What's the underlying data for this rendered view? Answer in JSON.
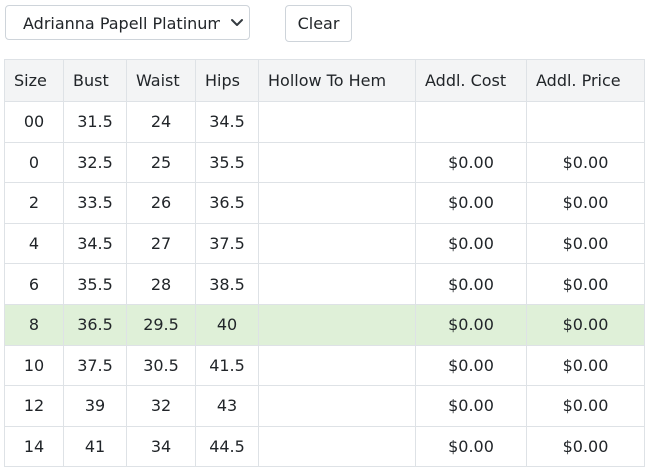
{
  "controls": {
    "select_value": "Adrianna Papell Platinum E",
    "clear_label": "Clear"
  },
  "table": {
    "headers": [
      "Size",
      "Bust",
      "Waist",
      "Hips",
      "Hollow To Hem",
      "Addl. Cost",
      "Addl. Price"
    ],
    "highlight_color": "#dff0d8",
    "rows": [
      {
        "size": "00",
        "bust": "31.5",
        "waist": "24",
        "hips": "34.5",
        "hollow": "",
        "cost": "",
        "price": "",
        "highlighted": false
      },
      {
        "size": "0",
        "bust": "32.5",
        "waist": "25",
        "hips": "35.5",
        "hollow": "",
        "cost": "$0.00",
        "price": "$0.00",
        "highlighted": false
      },
      {
        "size": "2",
        "bust": "33.5",
        "waist": "26",
        "hips": "36.5",
        "hollow": "",
        "cost": "$0.00",
        "price": "$0.00",
        "highlighted": false
      },
      {
        "size": "4",
        "bust": "34.5",
        "waist": "27",
        "hips": "37.5",
        "hollow": "",
        "cost": "$0.00",
        "price": "$0.00",
        "highlighted": false
      },
      {
        "size": "6",
        "bust": "35.5",
        "waist": "28",
        "hips": "38.5",
        "hollow": "",
        "cost": "$0.00",
        "price": "$0.00",
        "highlighted": false
      },
      {
        "size": "8",
        "bust": "36.5",
        "waist": "29.5",
        "hips": "40",
        "hollow": "",
        "cost": "$0.00",
        "price": "$0.00",
        "highlighted": true
      },
      {
        "size": "10",
        "bust": "37.5",
        "waist": "30.5",
        "hips": "41.5",
        "hollow": "",
        "cost": "$0.00",
        "price": "$0.00",
        "highlighted": false
      },
      {
        "size": "12",
        "bust": "39",
        "waist": "32",
        "hips": "43",
        "hollow": "",
        "cost": "$0.00",
        "price": "$0.00",
        "highlighted": false
      },
      {
        "size": "14",
        "bust": "41",
        "waist": "34",
        "hips": "44.5",
        "hollow": "",
        "cost": "$0.00",
        "price": "$0.00",
        "highlighted": false
      }
    ]
  }
}
